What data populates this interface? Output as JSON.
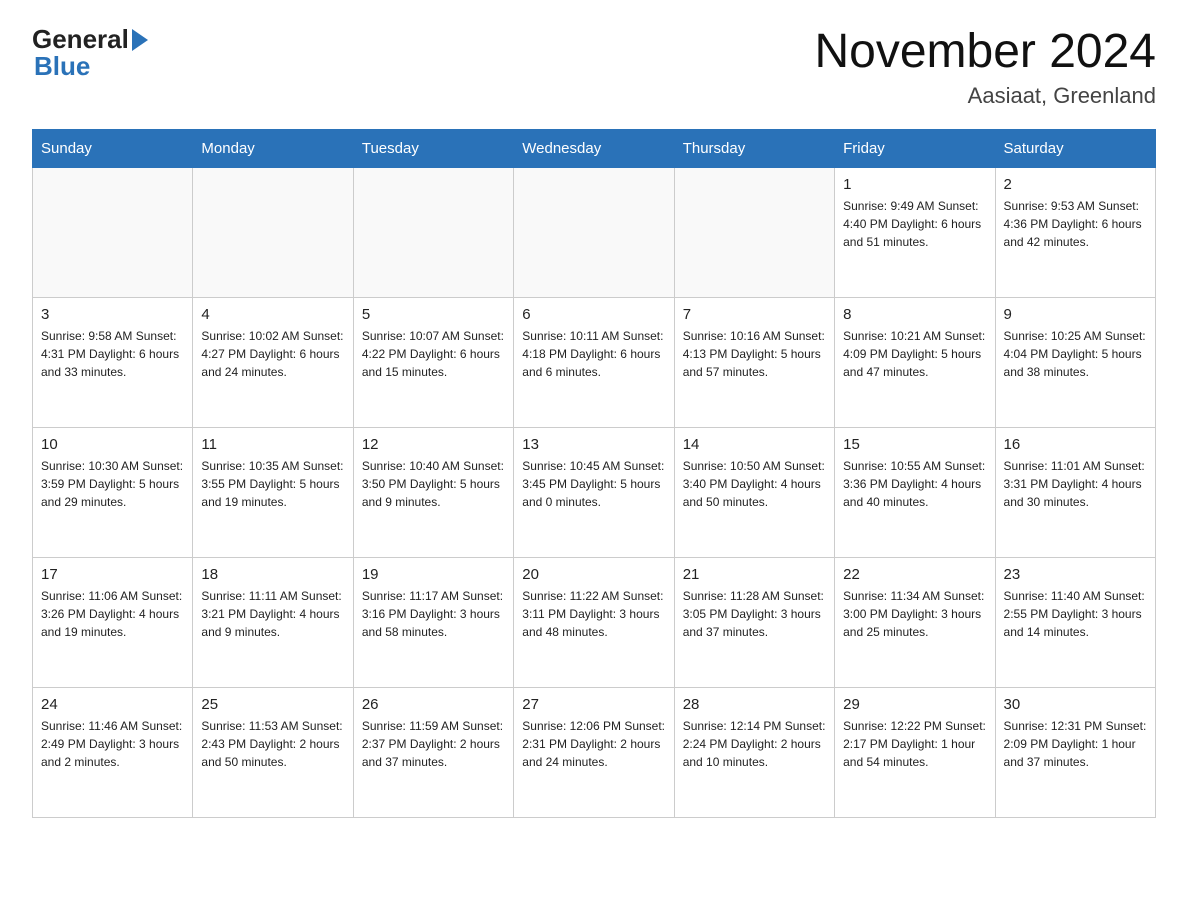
{
  "header": {
    "title": "November 2024",
    "subtitle": "Aasiaat, Greenland",
    "logo_general": "General",
    "logo_blue": "Blue"
  },
  "days_of_week": [
    "Sunday",
    "Monday",
    "Tuesday",
    "Wednesday",
    "Thursday",
    "Friday",
    "Saturday"
  ],
  "weeks": [
    [
      {
        "day": "",
        "info": ""
      },
      {
        "day": "",
        "info": ""
      },
      {
        "day": "",
        "info": ""
      },
      {
        "day": "",
        "info": ""
      },
      {
        "day": "",
        "info": ""
      },
      {
        "day": "1",
        "info": "Sunrise: 9:49 AM\nSunset: 4:40 PM\nDaylight: 6 hours\nand 51 minutes."
      },
      {
        "day": "2",
        "info": "Sunrise: 9:53 AM\nSunset: 4:36 PM\nDaylight: 6 hours\nand 42 minutes."
      }
    ],
    [
      {
        "day": "3",
        "info": "Sunrise: 9:58 AM\nSunset: 4:31 PM\nDaylight: 6 hours\nand 33 minutes."
      },
      {
        "day": "4",
        "info": "Sunrise: 10:02 AM\nSunset: 4:27 PM\nDaylight: 6 hours\nand 24 minutes."
      },
      {
        "day": "5",
        "info": "Sunrise: 10:07 AM\nSunset: 4:22 PM\nDaylight: 6 hours\nand 15 minutes."
      },
      {
        "day": "6",
        "info": "Sunrise: 10:11 AM\nSunset: 4:18 PM\nDaylight: 6 hours\nand 6 minutes."
      },
      {
        "day": "7",
        "info": "Sunrise: 10:16 AM\nSunset: 4:13 PM\nDaylight: 5 hours\nand 57 minutes."
      },
      {
        "day": "8",
        "info": "Sunrise: 10:21 AM\nSunset: 4:09 PM\nDaylight: 5 hours\nand 47 minutes."
      },
      {
        "day": "9",
        "info": "Sunrise: 10:25 AM\nSunset: 4:04 PM\nDaylight: 5 hours\nand 38 minutes."
      }
    ],
    [
      {
        "day": "10",
        "info": "Sunrise: 10:30 AM\nSunset: 3:59 PM\nDaylight: 5 hours\nand 29 minutes."
      },
      {
        "day": "11",
        "info": "Sunrise: 10:35 AM\nSunset: 3:55 PM\nDaylight: 5 hours\nand 19 minutes."
      },
      {
        "day": "12",
        "info": "Sunrise: 10:40 AM\nSunset: 3:50 PM\nDaylight: 5 hours\nand 9 minutes."
      },
      {
        "day": "13",
        "info": "Sunrise: 10:45 AM\nSunset: 3:45 PM\nDaylight: 5 hours\nand 0 minutes."
      },
      {
        "day": "14",
        "info": "Sunrise: 10:50 AM\nSunset: 3:40 PM\nDaylight: 4 hours\nand 50 minutes."
      },
      {
        "day": "15",
        "info": "Sunrise: 10:55 AM\nSunset: 3:36 PM\nDaylight: 4 hours\nand 40 minutes."
      },
      {
        "day": "16",
        "info": "Sunrise: 11:01 AM\nSunset: 3:31 PM\nDaylight: 4 hours\nand 30 minutes."
      }
    ],
    [
      {
        "day": "17",
        "info": "Sunrise: 11:06 AM\nSunset: 3:26 PM\nDaylight: 4 hours\nand 19 minutes."
      },
      {
        "day": "18",
        "info": "Sunrise: 11:11 AM\nSunset: 3:21 PM\nDaylight: 4 hours\nand 9 minutes."
      },
      {
        "day": "19",
        "info": "Sunrise: 11:17 AM\nSunset: 3:16 PM\nDaylight: 3 hours\nand 58 minutes."
      },
      {
        "day": "20",
        "info": "Sunrise: 11:22 AM\nSunset: 3:11 PM\nDaylight: 3 hours\nand 48 minutes."
      },
      {
        "day": "21",
        "info": "Sunrise: 11:28 AM\nSunset: 3:05 PM\nDaylight: 3 hours\nand 37 minutes."
      },
      {
        "day": "22",
        "info": "Sunrise: 11:34 AM\nSunset: 3:00 PM\nDaylight: 3 hours\nand 25 minutes."
      },
      {
        "day": "23",
        "info": "Sunrise: 11:40 AM\nSunset: 2:55 PM\nDaylight: 3 hours\nand 14 minutes."
      }
    ],
    [
      {
        "day": "24",
        "info": "Sunrise: 11:46 AM\nSunset: 2:49 PM\nDaylight: 3 hours\nand 2 minutes."
      },
      {
        "day": "25",
        "info": "Sunrise: 11:53 AM\nSunset: 2:43 PM\nDaylight: 2 hours\nand 50 minutes."
      },
      {
        "day": "26",
        "info": "Sunrise: 11:59 AM\nSunset: 2:37 PM\nDaylight: 2 hours\nand 37 minutes."
      },
      {
        "day": "27",
        "info": "Sunrise: 12:06 PM\nSunset: 2:31 PM\nDaylight: 2 hours\nand 24 minutes."
      },
      {
        "day": "28",
        "info": "Sunrise: 12:14 PM\nSunset: 2:24 PM\nDaylight: 2 hours\nand 10 minutes."
      },
      {
        "day": "29",
        "info": "Sunrise: 12:22 PM\nSunset: 2:17 PM\nDaylight: 1 hour and\n54 minutes."
      },
      {
        "day": "30",
        "info": "Sunrise: 12:31 PM\nSunset: 2:09 PM\nDaylight: 1 hour and\n37 minutes."
      }
    ]
  ]
}
